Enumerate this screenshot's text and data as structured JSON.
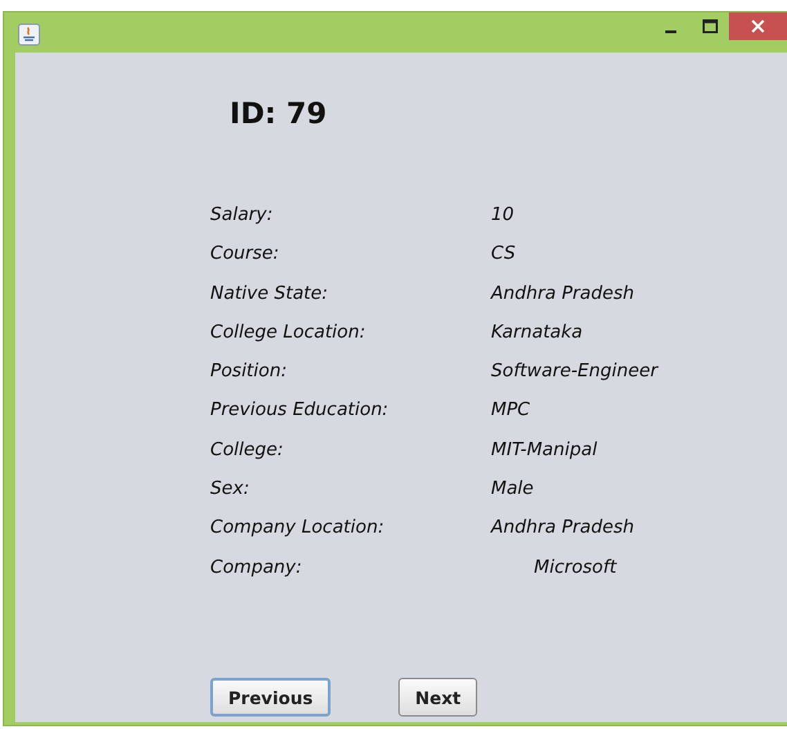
{
  "window": {
    "controls": [
      {
        "kind": "minimize"
      },
      {
        "kind": "maximize"
      },
      {
        "kind": "close"
      }
    ]
  },
  "heading": "ID: 79",
  "fields": [
    {
      "label": "Salary:",
      "value": "10",
      "indented": false
    },
    {
      "label": "Course:",
      "value": "CS",
      "indented": false
    },
    {
      "label": "Native State:",
      "value": "Andhra Pradesh",
      "indented": false
    },
    {
      "label": "College Location:",
      "value": "Karnataka",
      "indented": false
    },
    {
      "label": "Position:",
      "value": "Software-Engineer",
      "indented": false
    },
    {
      "label": "Previous Education:",
      "value": "MPC",
      "indented": false
    },
    {
      "label": "College:",
      "value": "MIT-Manipal",
      "indented": false
    },
    {
      "label": "Sex:",
      "value": "Male",
      "indented": false
    },
    {
      "label": "Company Location:",
      "value": "Andhra Pradesh",
      "indented": false
    },
    {
      "label": "Company:",
      "value": "Microsoft",
      "indented": true
    }
  ],
  "buttons": [
    {
      "label": "Previous",
      "focused": true
    },
    {
      "label": "Next",
      "focused": false
    }
  ]
}
